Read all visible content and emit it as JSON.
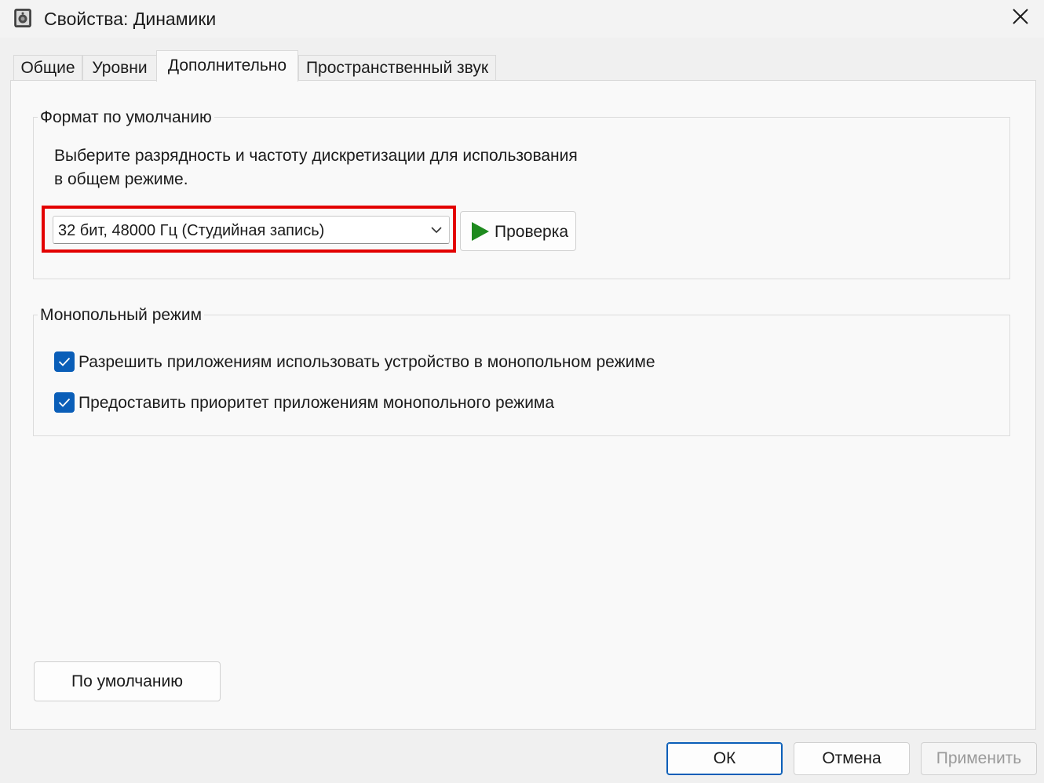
{
  "window": {
    "title": "Свойства: Динамики"
  },
  "tabs": [
    {
      "label": "Общие",
      "active": false
    },
    {
      "label": "Уровни",
      "active": false
    },
    {
      "label": "Дополнительно",
      "active": true
    },
    {
      "label": "Пространственный звук",
      "active": false
    }
  ],
  "default_format": {
    "group_title": "Формат по умолчанию",
    "description_line1": "Выберите разрядность и частоту дискретизации для использования",
    "description_line2": "в общем режиме.",
    "selected_format": "32 бит, 48000 Гц (Студийная запись)",
    "test_button": "Проверка"
  },
  "exclusive_mode": {
    "group_title": "Монопольный режим",
    "options": [
      {
        "label": "Разрешить приложениям использовать устройство в монопольном режиме",
        "checked": true
      },
      {
        "label": "Предоставить приоритет приложениям монопольного режима",
        "checked": true
      }
    ]
  },
  "buttons": {
    "restore_defaults": "По умолчанию",
    "ok": "ОК",
    "cancel": "Отмена",
    "apply": "Применить"
  },
  "colors": {
    "highlight_border": "#e30000",
    "accent": "#0a5eb8",
    "play_icon": "#1e8a1e"
  },
  "icons": {
    "app": "speaker-icon",
    "close": "close-icon",
    "dropdown": "chevron-down-icon",
    "play": "play-icon",
    "check": "checkmark-icon"
  }
}
